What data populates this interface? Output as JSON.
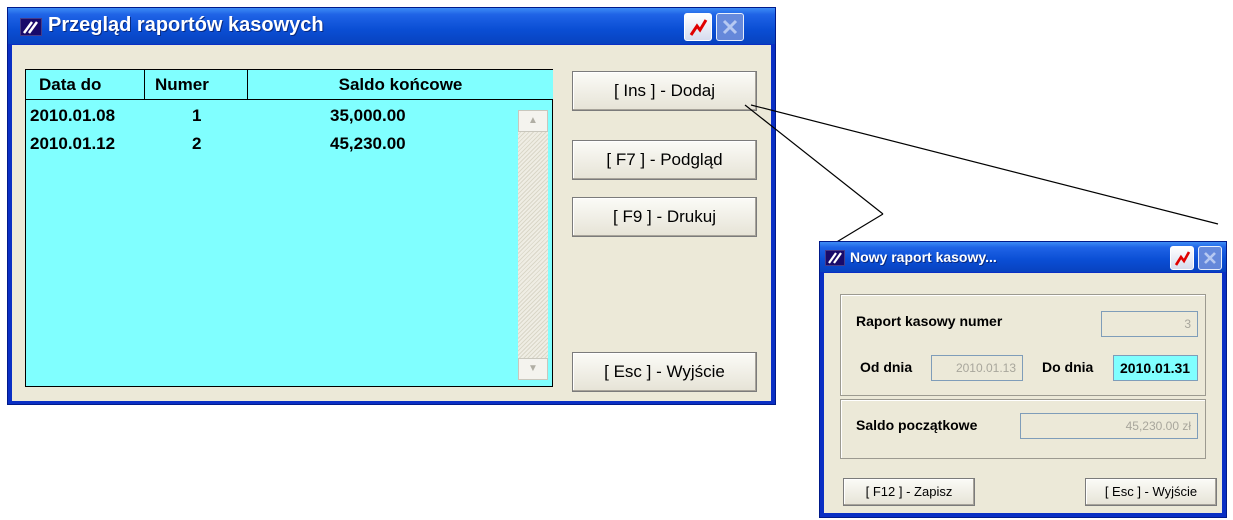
{
  "main_window": {
    "title": "Przegląd raportów kasowych",
    "columns": [
      "Data do",
      "Numer",
      "Saldo końcowe"
    ],
    "rows": [
      {
        "data_do": "2010.01.08",
        "numer": "1",
        "saldo": "35,000.00"
      },
      {
        "data_do": "2010.01.12",
        "numer": "2",
        "saldo": "45,230.00"
      }
    ],
    "buttons": {
      "add": "[ Ins ] - Dodaj",
      "preview": "[ F7 ] - Podgląd",
      "print": "[ F9 ] - Drukuj",
      "exit": "[ Esc ] - Wyjście"
    },
    "scroll_up_icon": "▲",
    "scroll_down_icon": "▼"
  },
  "dialog": {
    "title": "Nowy raport kasowy...",
    "report_number_label": "Raport kasowy numer",
    "report_number_value": "3",
    "from_label": "Od dnia",
    "from_value": "2010.01.13",
    "to_label": "Do dnia",
    "to_value": "2010.01.31",
    "opening_balance_label": "Saldo początkowe",
    "opening_balance_value": "45,230.00 zł",
    "save_button": "[ F12 ] - Zapisz",
    "exit_button": "[ Esc ] - Wyjście"
  },
  "colors": {
    "grid_background": "#80ffff",
    "titlebar": "#0a4ed4",
    "client": "#ece9d8"
  }
}
